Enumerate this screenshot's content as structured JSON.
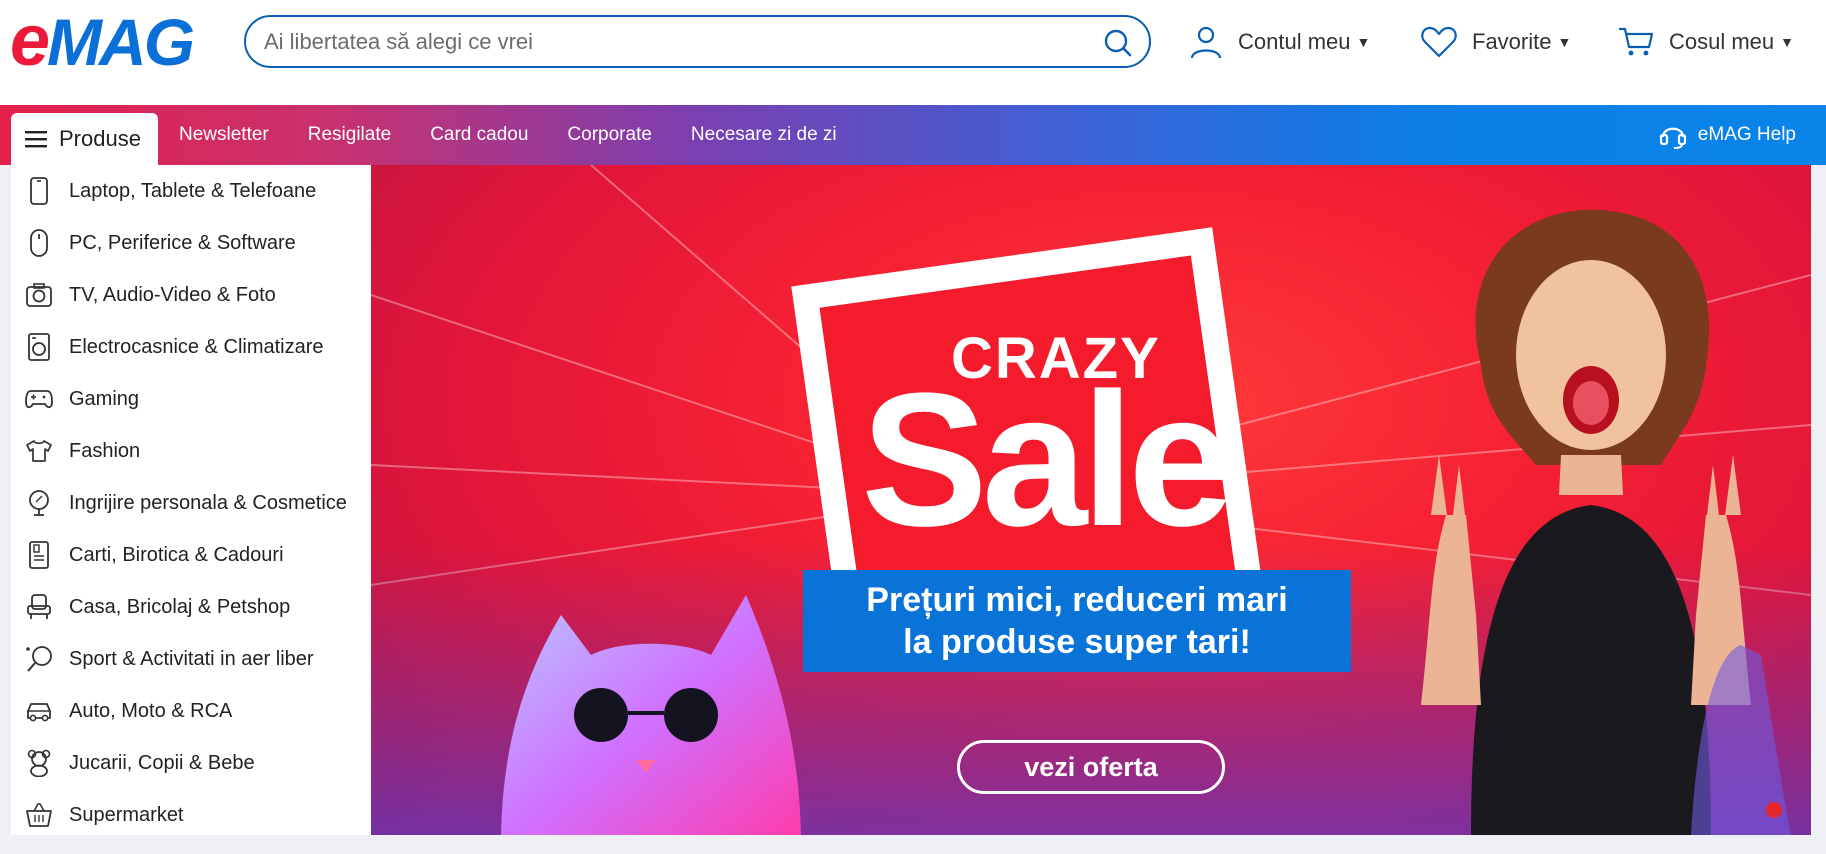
{
  "header": {
    "logo_text_e": "e",
    "logo_text_mag": "MAG",
    "search_placeholder": "Ai libertatea să alegi ce vrei",
    "account_label": "Contul meu",
    "favorites_label": "Favorite",
    "cart_label": "Cosul meu"
  },
  "navbar": {
    "products_label": "Produse",
    "links": [
      "Newsletter",
      "Resigilate",
      "Card cadou",
      "Corporate",
      "Necesare zi de zi"
    ],
    "help_label": "eMAG Help"
  },
  "menu": {
    "items": [
      {
        "label": "Laptop, Tablete & Telefoane",
        "icon": "phone-icon"
      },
      {
        "label": "PC, Periferice & Software",
        "icon": "mouse-icon"
      },
      {
        "label": "TV, Audio-Video & Foto",
        "icon": "camera-icon"
      },
      {
        "label": "Electrocasnice & Climatizare",
        "icon": "washing-machine-icon"
      },
      {
        "label": "Gaming",
        "icon": "gamepad-icon"
      },
      {
        "label": "Fashion",
        "icon": "tshirt-icon"
      },
      {
        "label": "Ingrijire personala & Cosmetice",
        "icon": "mirror-icon"
      },
      {
        "label": "Carti, Birotica & Cadouri",
        "icon": "book-icon"
      },
      {
        "label": "Casa, Bricolaj & Petshop",
        "icon": "armchair-icon"
      },
      {
        "label": "Sport & Activitati in aer liber",
        "icon": "racket-icon"
      },
      {
        "label": "Auto, Moto & RCA",
        "icon": "car-icon"
      },
      {
        "label": "Jucarii, Copii & Bebe",
        "icon": "teddy-bear-icon"
      },
      {
        "label": "Supermarket",
        "icon": "basket-icon"
      }
    ]
  },
  "banner": {
    "headline_small": "CRAZY",
    "headline_big": "Sale",
    "subline_1": "Prețuri mici, reduceri mari",
    "subline_2": "la produse super tari!",
    "cta_label": "vezi oferta"
  },
  "colors": {
    "brand_red": "#ec1a3a",
    "brand_blue": "#0a6fd6",
    "banner_red": "#f31b2c",
    "banner_blue_box": "#0a73d8"
  }
}
